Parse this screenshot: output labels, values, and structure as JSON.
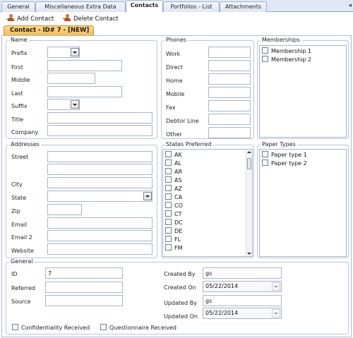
{
  "tabs": [
    {
      "label": "General",
      "active": false
    },
    {
      "label": "Miscellaneous Extra Data",
      "active": false
    },
    {
      "label": "Contacts",
      "active": true
    },
    {
      "label": "Portfolios - List",
      "active": false
    },
    {
      "label": "Attachments",
      "active": false
    }
  ],
  "tab_scroll_glyph": "◂",
  "toolbar": {
    "add_contact": "Add Contact",
    "delete_contact": "Delete Contact"
  },
  "record_tab": "Contact - ID# 7 - [NEW]",
  "name_group": {
    "title": "Name",
    "prefix": "Prefix",
    "first": "First",
    "middle": "Middle",
    "last": "Last",
    "suffix": "Suffix",
    "title_label": "Title",
    "company": "Company",
    "values": {
      "prefix": "",
      "first": "",
      "middle": "",
      "last": "",
      "suffix": "",
      "title": "",
      "company": ""
    }
  },
  "phones_group": {
    "title": "Phones",
    "work": "Work",
    "direct": "Direct",
    "home": "Home",
    "mobile": "Mobile",
    "fax": "Fax",
    "debtor_line": "Debtor Line",
    "other": "Other",
    "values": {
      "work": "",
      "direct": "",
      "home": "",
      "mobile": "",
      "fax": "",
      "debtor_line": "",
      "other": ""
    }
  },
  "memberships_group": {
    "title": "Memberships",
    "items": [
      "Membership 1",
      "Membership 2"
    ]
  },
  "addresses_group": {
    "title": "Addresses",
    "street": "Street",
    "city": "City",
    "state": "State",
    "zip": "Zip",
    "email": "Email",
    "email2": "Email 2",
    "website": "Website",
    "values": {
      "street1": "",
      "street2": "",
      "city": "",
      "state": "",
      "zip": "",
      "email": "",
      "email2": "",
      "website": ""
    }
  },
  "states_group": {
    "title": "States Preferred",
    "items": [
      "AK",
      "AL",
      "AR",
      "AS",
      "AZ",
      "CA",
      "CO",
      "CT",
      "DC",
      "DE",
      "FL",
      "FM"
    ]
  },
  "paper_types_group": {
    "title": "Paper Types",
    "items": [
      "Paper type 1",
      "Paper type 2"
    ]
  },
  "general_group": {
    "title": "General",
    "id": "ID",
    "referred": "Referred",
    "source": "Source",
    "created_by": "Created By",
    "created_on": "Created On",
    "updated_by": "Updated By",
    "updated_on": "Updated On",
    "confidentiality": "Confidentiality Received",
    "questionnaire": "Questionnaire Received",
    "values": {
      "id": "7",
      "referred": "",
      "source": "",
      "created_by": "gs",
      "created_on": "05/22/2014",
      "updated_by": "gs",
      "updated_on": "05/22/2014"
    }
  },
  "colors": {
    "tab_bg": "#dfe8f4",
    "record_tab": "#f5b94a",
    "border": "#a9bcd6"
  }
}
